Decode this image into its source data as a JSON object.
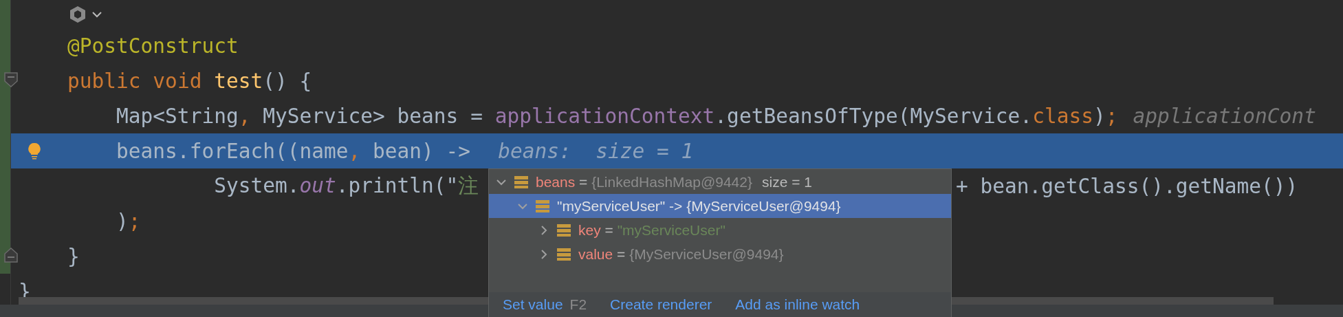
{
  "editor": {
    "lines": [
      {
        "kind": "icons",
        "changed": true,
        "current": false
      },
      {
        "kind": "code",
        "changed": true,
        "current": false,
        "tokens": [
          {
            "kind": "annotation",
            "text": "@PostConstruct"
          }
        ]
      },
      {
        "kind": "code",
        "changed": true,
        "current": false,
        "gutter": {
          "kind": "fold_start"
        },
        "tokens": [
          {
            "kind": "keyword",
            "text": "public void "
          },
          {
            "kind": "method",
            "text": "test"
          },
          {
            "kind": "plain",
            "text": "() {"
          }
        ],
        "children": [
          {
            "kind": "code",
            "changed": true,
            "current": false,
            "tokens": [
              {
                "kind": "plain",
                "text": "Map<String"
              },
              {
                "kind": "keyword",
                "text": ", "
              },
              {
                "kind": "plain",
                "text": "MyService> beans = "
              },
              {
                "kind": "field",
                "text": "applicationContext"
              },
              {
                "kind": "plain",
                "text": ".getBeansOfType(MyService."
              },
              {
                "kind": "keyword",
                "text": "class"
              },
              {
                "kind": "plain",
                "text": ")"
              },
              {
                "kind": "keyword",
                "text": ";"
              }
            ],
            "hint": "applicationCont"
          },
          {
            "kind": "code",
            "changed": true,
            "current": true,
            "gutter": {
              "kind": "bulb"
            },
            "tokens": [
              {
                "kind": "plain",
                "text": "beans.forEach((name"
              },
              {
                "kind": "keyword",
                "text": ", "
              },
              {
                "kind": "plain",
                "text": "bean) ->"
              }
            ],
            "hint": "beans:  size = 1",
            "children": [
              {
                "kind": "wrapped",
                "changed": true,
                "current": false,
                "tokens": [
                  {
                    "kind": "plain",
                    "text": "System."
                  },
                  {
                    "kind": "static",
                    "text": "out"
                  },
                  {
                    "kind": "plain",
                    "text": ".println(\""
                  },
                  {
                    "kind": "string",
                    "text": "注"
                  }
                ],
                "continuation": [
                  {
                    "kind": "plain",
                    "text": "+ bean.getClass().getName())"
                  }
                ]
              }
            ]
          },
          {
            "kind": "code",
            "changed": true,
            "current": false,
            "tokens": [
              {
                "kind": "plain",
                "text": ")"
              },
              {
                "kind": "keyword",
                "text": ";"
              }
            ]
          },
          {
            "kind": "closing",
            "changed": true,
            "current": false,
            "gutter": {
              "kind": "fold_end"
            },
            "tokens": [
              {
                "kind": "plain",
                "text": "}"
              }
            ]
          }
        ]
      },
      {
        "kind": "closing",
        "changed": false,
        "current": false,
        "tokens": [
          {
            "kind": "plain",
            "text": "}"
          }
        ]
      }
    ]
  },
  "popup": {
    "tree": [
      {
        "kind": "field",
        "name": "beans",
        "separator": "=",
        "value": {
          "kind": "object",
          "text": "{LinkedHashMap@9442}"
        },
        "note": "size = 1",
        "expanded": true,
        "selected": false,
        "children": [
          {
            "kind": "entry",
            "name": "\"myServiceUser\"",
            "separator": "->",
            "value": {
              "kind": "object",
              "text": "{MyServiceUser@9494}"
            },
            "expanded": true,
            "selected": true,
            "children": [
              {
                "kind": "field",
                "name": "key",
                "separator": "=",
                "value": {
                  "kind": "string",
                  "text": "\"myServiceUser\""
                },
                "expanded": false,
                "selected": false
              },
              {
                "kind": "field",
                "name": "value",
                "separator": "=",
                "value": {
                  "kind": "object",
                  "text": "{MyServiceUser@9494}"
                },
                "expanded": false,
                "selected": false
              }
            ]
          }
        ]
      }
    ],
    "actions": [
      {
        "label": "Set value",
        "shortcut": "F2"
      },
      {
        "label": "Create renderer"
      },
      {
        "label": "Add as inline watch"
      }
    ]
  }
}
